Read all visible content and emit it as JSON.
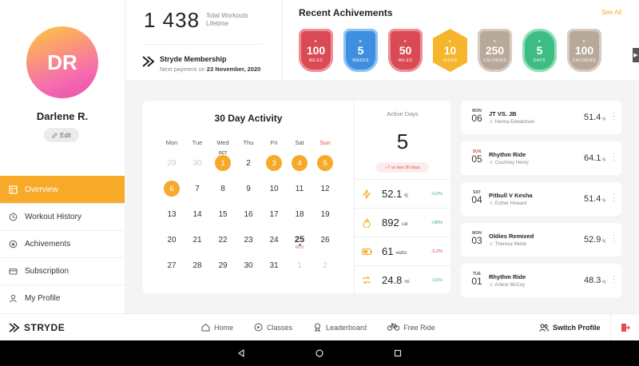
{
  "profile": {
    "initials": "DR",
    "name": "Darlene R.",
    "edit_label": "Edit"
  },
  "nav": {
    "items": [
      {
        "label": "Overview",
        "icon": "grid-icon",
        "active": true
      },
      {
        "label": "Workout History",
        "icon": "history-icon"
      },
      {
        "label": "Achivements",
        "icon": "badge-icon"
      },
      {
        "label": "Subscription",
        "icon": "card-icon"
      },
      {
        "label": "My Profile",
        "icon": "user-icon"
      }
    ]
  },
  "stats": {
    "total": "1 438",
    "total_label_1": "Total Workouts",
    "total_label_2": "Lifetime",
    "membership_title": "Stryde Membership",
    "membership_prefix": "Next payment on ",
    "membership_date": "23 November, 2020"
  },
  "achievements": {
    "title": "Recent Achivements",
    "see_all": "See All",
    "badges": [
      {
        "value": "100",
        "unit": "MILES",
        "shape": "shield",
        "color": "#d94a55"
      },
      {
        "value": "5",
        "unit": "WEEKS",
        "shape": "shield",
        "color": "#3f8fe0"
      },
      {
        "value": "50",
        "unit": "MILES",
        "shape": "shield",
        "color": "#d94a55"
      },
      {
        "value": "10",
        "unit": "RIDES",
        "shape": "hex",
        "color": "#f7b52c"
      },
      {
        "value": "250",
        "unit": "CALORIES",
        "shape": "shield",
        "color": "#b8a89a"
      },
      {
        "value": "5",
        "unit": "DAYS",
        "shape": "round",
        "color": "#3dbd83"
      },
      {
        "value": "100",
        "unit": "CALORIES",
        "shape": "shield",
        "color": "#b8a89a"
      }
    ]
  },
  "calendar": {
    "title": "30 Day Activity",
    "weekdays": [
      "Mon",
      "Tue",
      "Wed",
      "Thu",
      "Fri",
      "Sat",
      "Sun"
    ],
    "month_tag": "OCT",
    "next_month_tag": "NOV",
    "weeks": [
      [
        {
          "d": "29",
          "muted": true
        },
        {
          "d": "30",
          "muted": true
        },
        {
          "d": "1",
          "active": true,
          "tag": "OCT"
        },
        {
          "d": "2"
        },
        {
          "d": "3",
          "active": true
        },
        {
          "d": "4",
          "active": true
        },
        {
          "d": "5",
          "active": true
        }
      ],
      [
        {
          "d": "6",
          "active": true
        },
        {
          "d": "7"
        },
        {
          "d": "8"
        },
        {
          "d": "9"
        },
        {
          "d": "10"
        },
        {
          "d": "11"
        },
        {
          "d": "12"
        }
      ],
      [
        {
          "d": "13"
        },
        {
          "d": "14"
        },
        {
          "d": "15"
        },
        {
          "d": "16"
        },
        {
          "d": "17"
        },
        {
          "d": "18"
        },
        {
          "d": "19"
        }
      ],
      [
        {
          "d": "20"
        },
        {
          "d": "21"
        },
        {
          "d": "22"
        },
        {
          "d": "23"
        },
        {
          "d": "24"
        },
        {
          "d": "25",
          "today": true,
          "tag2": "NOV"
        },
        {
          "d": "26"
        }
      ],
      [
        {
          "d": "27"
        },
        {
          "d": "28"
        },
        {
          "d": "29"
        },
        {
          "d": "30"
        },
        {
          "d": "31"
        },
        {
          "d": "1",
          "muted": true
        },
        {
          "d": "2",
          "muted": true
        }
      ]
    ]
  },
  "active_days": {
    "label": "Active Days",
    "value": "5",
    "delta": "−7 vs last 30 days"
  },
  "metrics": [
    {
      "icon": "bolt-icon",
      "value": "52.1",
      "unit": "kj",
      "delta": "+12%",
      "dir": "pos",
      "color": "#f7a928"
    },
    {
      "icon": "flame-icon",
      "value": "892",
      "unit": "cal",
      "delta": "+38%",
      "dir": "pos",
      "color": "#f7a928"
    },
    {
      "icon": "battery-icon",
      "value": "61",
      "unit": "watts",
      "delta": "-0.2%",
      "dir": "neg",
      "color": "#f7a928"
    },
    {
      "icon": "distance-icon",
      "value": "24.8",
      "unit": "mi",
      "delta": "+11%",
      "dir": "pos",
      "color": "#f7a928"
    }
  ],
  "workouts": [
    {
      "dow": "MON",
      "day": "06",
      "name": "JT VS. JB",
      "instructor": "Hanna Edwardsen",
      "value": "51.4",
      "unit": "kj"
    },
    {
      "dow": "SUN",
      "day": "05",
      "name": "Rhythm Ride",
      "instructor": "Courtney Henry",
      "value": "64.1",
      "unit": "kj",
      "sun": true
    },
    {
      "dow": "SAT",
      "day": "04",
      "name": "Pitbull V Kesha",
      "instructor": "Esther Howard",
      "value": "51.4",
      "unit": "kj"
    },
    {
      "dow": "MON",
      "day": "03",
      "name": "Oldies Remixed",
      "instructor": "Theresa Webb",
      "value": "52.9",
      "unit": "kj"
    },
    {
      "dow": "TUE",
      "day": "01",
      "name": "Rhythm Ride",
      "instructor": "Arlene McCoy",
      "value": "48.3",
      "unit": "kj"
    }
  ],
  "bottom": {
    "brand": "STRYDE",
    "nav": [
      {
        "label": "Home",
        "icon": "home-icon"
      },
      {
        "label": "Classes",
        "icon": "play-icon"
      },
      {
        "label": "Leaderboard",
        "icon": "medal-icon"
      },
      {
        "label": "Free Ride",
        "icon": "bike-icon"
      }
    ],
    "switch_label": "Switch Profile"
  }
}
